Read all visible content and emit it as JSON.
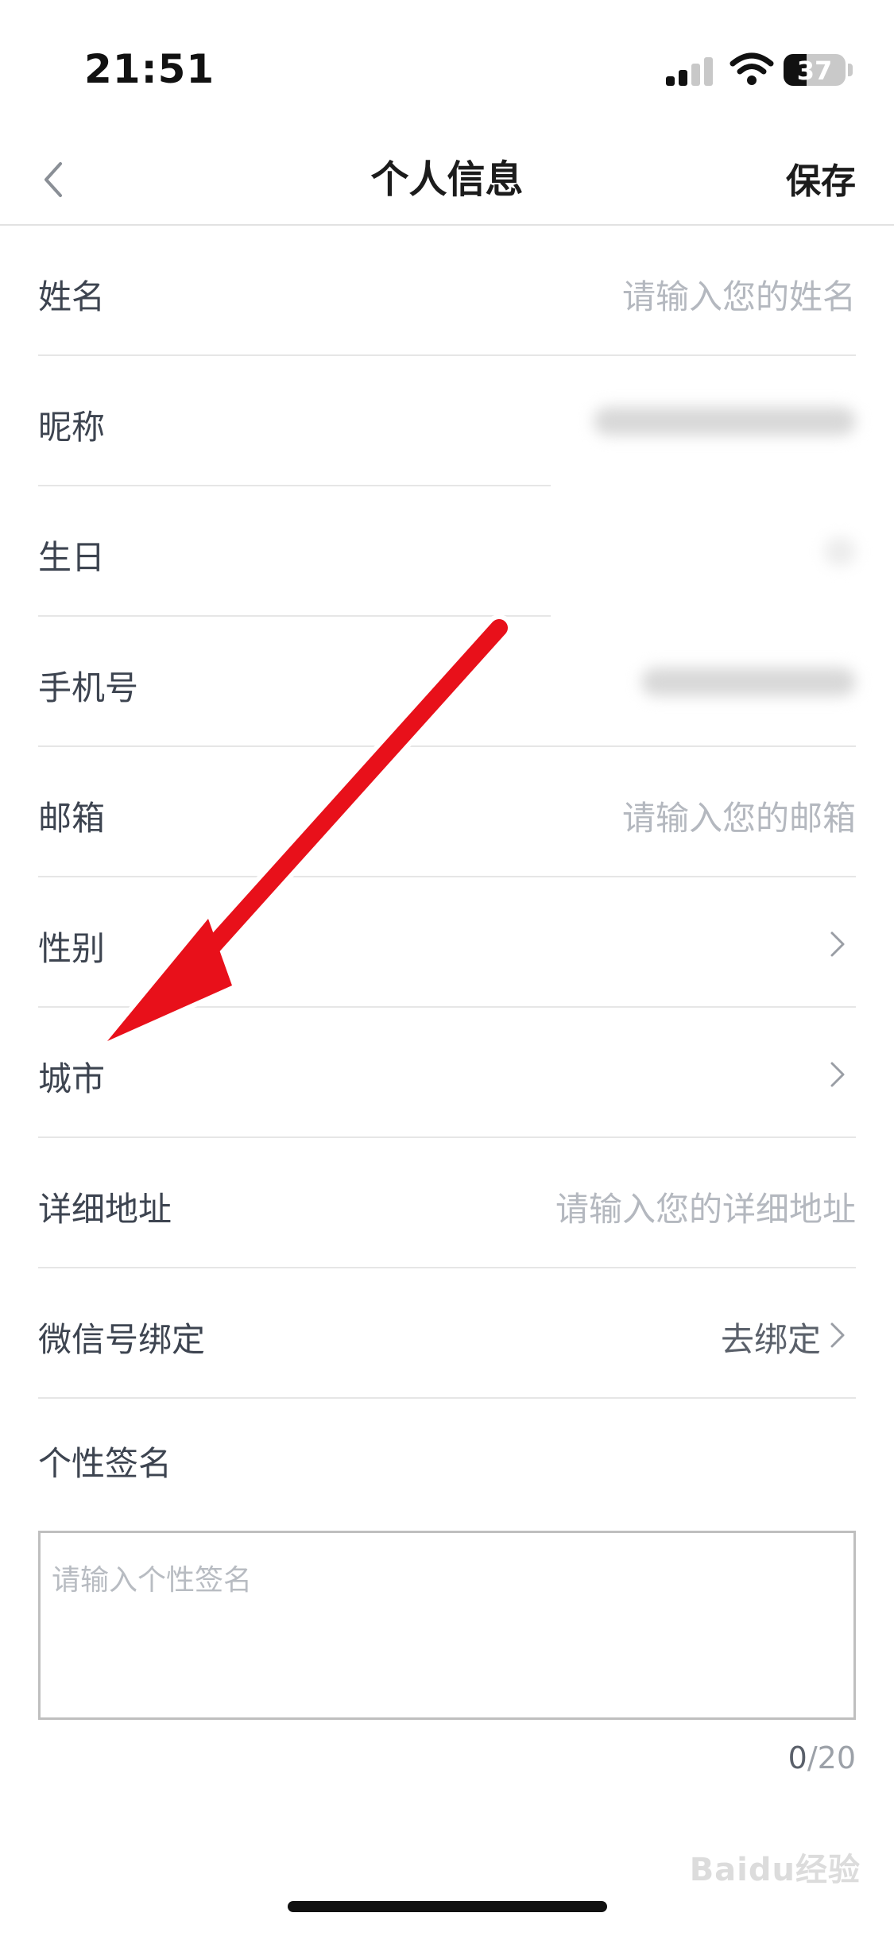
{
  "status_bar": {
    "time": "21:51",
    "battery_percent": "37",
    "battery_level": 0.37
  },
  "nav": {
    "back_icon": "chevron-left-icon",
    "title": "个人信息",
    "save_label": "保存"
  },
  "rows": [
    {
      "label": "姓名",
      "value": "请输入您的姓名",
      "kind": "placeholder"
    },
    {
      "label": "昵称",
      "kind": "blurred"
    },
    {
      "label": "生日",
      "kind": "blurred-small"
    },
    {
      "label": "手机号",
      "kind": "blurred"
    },
    {
      "label": "邮箱",
      "value": "请输入您的邮箱",
      "kind": "placeholder"
    },
    {
      "label": "性别",
      "kind": "chevron"
    },
    {
      "label": "城市",
      "kind": "chevron"
    },
    {
      "label": "详细地址",
      "value": "请输入您的详细地址",
      "kind": "placeholder"
    },
    {
      "label": "微信号绑定",
      "value": "去绑定",
      "kind": "link-chevron"
    }
  ],
  "signature": {
    "label": "个性签名",
    "placeholder": "请输入个性签名",
    "count": "0",
    "max": "/20"
  },
  "annotation": {
    "color": "#e8101a"
  },
  "watermark": "Baidu经验"
}
